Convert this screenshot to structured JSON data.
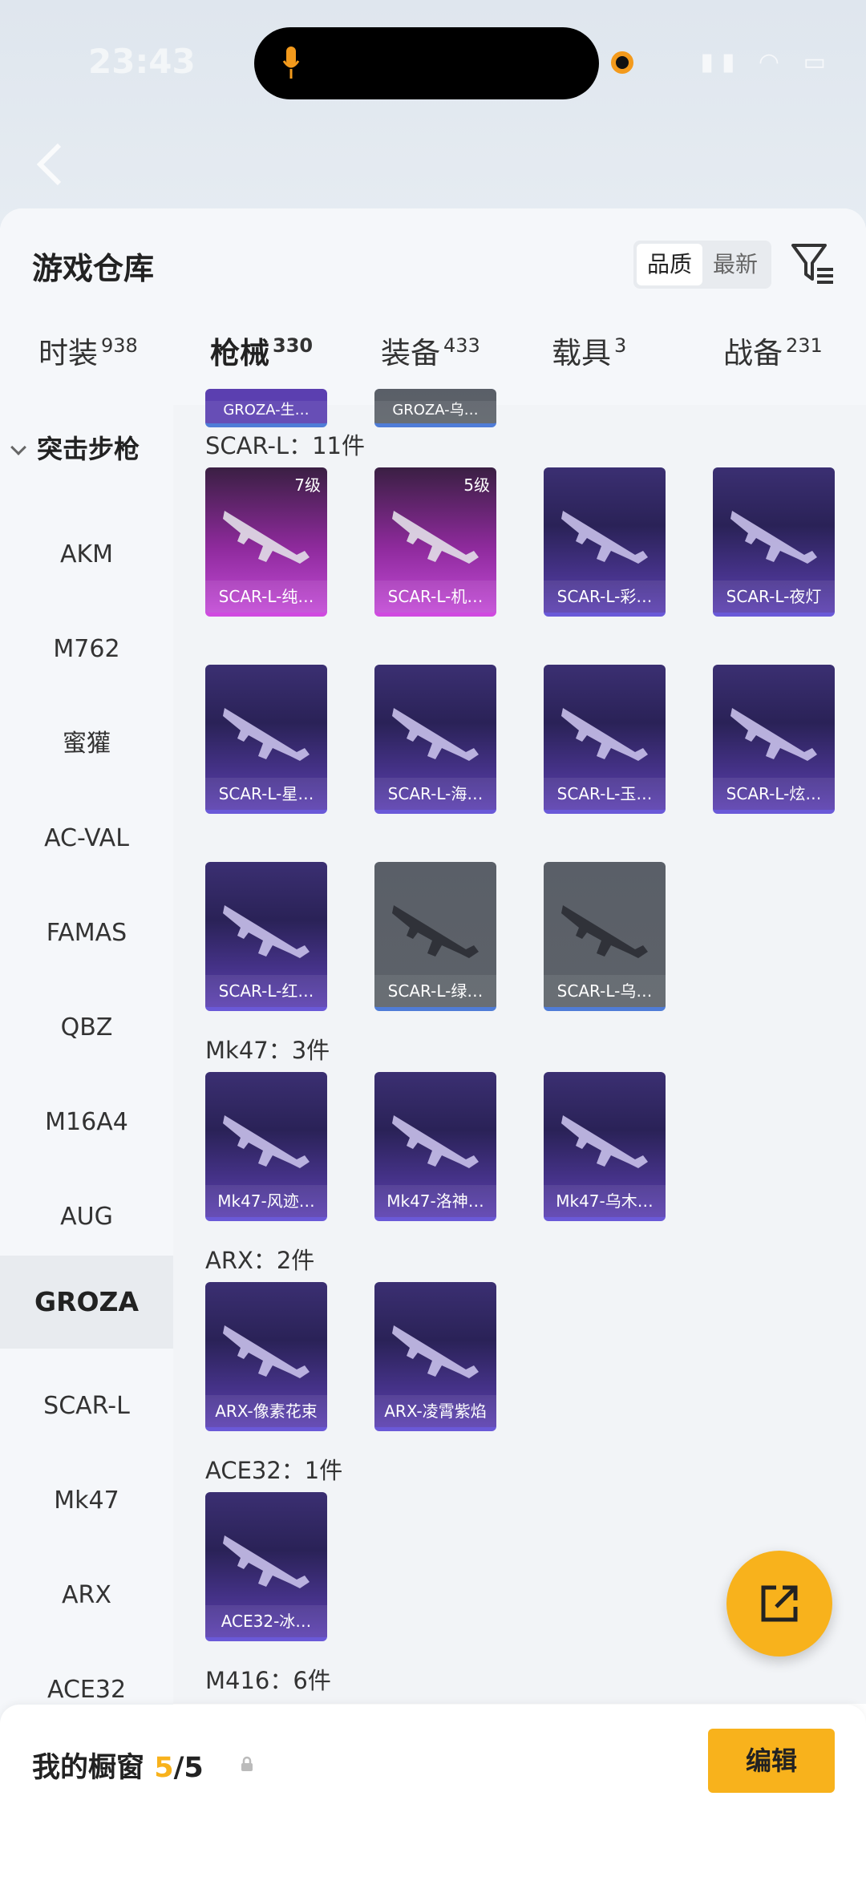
{
  "status_bar": {
    "time": "23:43"
  },
  "header": {
    "title": "游戏仓库",
    "sort_options": [
      "品质",
      "最新"
    ],
    "sort_active": "品质"
  },
  "tabs": [
    {
      "label": "时装",
      "count": "938"
    },
    {
      "label": "枪械",
      "count": "330"
    },
    {
      "label": "装备",
      "count": "433"
    },
    {
      "label": "载具",
      "count": "3"
    },
    {
      "label": "战备",
      "count": "231"
    }
  ],
  "sidebar": {
    "category": "突击步枪",
    "items": [
      "AKM",
      "M762",
      "蜜獾",
      "AC-VAL",
      "FAMAS",
      "QBZ",
      "M16A4",
      "AUG",
      "GROZA",
      "SCAR-L",
      "Mk47",
      "ARX",
      "ACE32"
    ],
    "active": "GROZA"
  },
  "groups": [
    {
      "label": "SCAR-L：11件",
      "items": [
        {
          "name": "SCAR-L-纯…",
          "rarity": "pink",
          "level": "7级"
        },
        {
          "name": "SCAR-L-机…",
          "rarity": "pink",
          "level": "5级"
        },
        {
          "name": "SCAR-L-彩…",
          "rarity": "purple"
        },
        {
          "name": "SCAR-L-夜灯",
          "rarity": "purple"
        },
        {
          "name": "SCAR-L-星…",
          "rarity": "purple"
        },
        {
          "name": "SCAR-L-海…",
          "rarity": "purple"
        },
        {
          "name": "SCAR-L-玉…",
          "rarity": "purple"
        },
        {
          "name": "SCAR-L-炫…",
          "rarity": "purple"
        },
        {
          "name": "SCAR-L-红…",
          "rarity": "purple"
        },
        {
          "name": "SCAR-L-绿…",
          "rarity": "grey"
        },
        {
          "name": "SCAR-L-乌…",
          "rarity": "grey"
        }
      ]
    },
    {
      "label": "Mk47：3件",
      "items": [
        {
          "name": "Mk47-风迹…",
          "rarity": "purple"
        },
        {
          "name": "Mk47-洛神…",
          "rarity": "purple"
        },
        {
          "name": "Mk47-乌木…",
          "rarity": "purple"
        }
      ]
    },
    {
      "label": "ARX：2件",
      "items": [
        {
          "name": "ARX-像素花束",
          "rarity": "purple"
        },
        {
          "name": "ARX-凌霄紫焰",
          "rarity": "purple"
        }
      ]
    },
    {
      "label": "ACE32：1件",
      "items": [
        {
          "name": "ACE32-冰…",
          "rarity": "purple"
        }
      ]
    },
    {
      "label": "M416：6件",
      "items": []
    }
  ],
  "partial_top": [
    "GROZA-生…",
    "GROZA-乌…"
  ],
  "bottom": {
    "showcase_label": "我的橱窗",
    "showcase_count": "5",
    "showcase_total": "/5",
    "edit_label": "编辑"
  }
}
